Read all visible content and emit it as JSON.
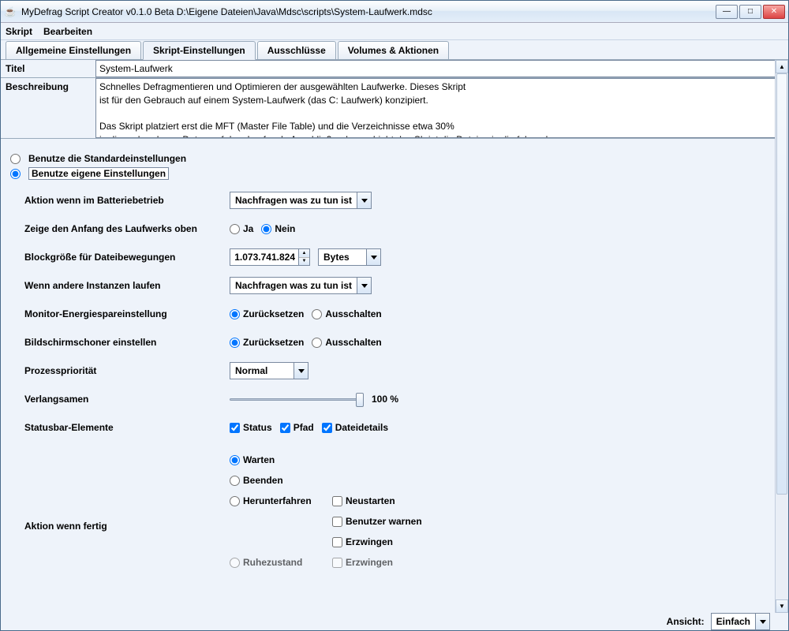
{
  "window": {
    "title": "MyDefrag Script Creator v0.1.0 Beta D:\\Eigene Dateien\\Java\\Mdsc\\scripts\\System-Laufwerk.mdsc"
  },
  "menu": {
    "script": "Skript",
    "edit": "Bearbeiten"
  },
  "tabs": {
    "general": "Allgemeine Einstellungen",
    "script": "Skript-Einstellungen",
    "excludes": "Ausschlüsse",
    "volumes": "Volumes & Aktionen"
  },
  "fields": {
    "title_label": "Titel",
    "title_value": "System-Laufwerk",
    "desc_label": "Beschreibung",
    "desc_value": "Schnelles Defragmentieren und Optimieren der ausgewählten Laufwerke. Dieses Skript\nist für den Gebrauch auf einem System-Laufwerk (das C: Laufwerk) konzipiert.\n\nDas Skript platziert erst die MFT (Master File Table) und die Verzeichnisse etwa 30%\nin die vorhandenen Daten auf dem Laufwerk. Anschließend verschiebt das Skript die Dateien in die folgenden"
  },
  "mode": {
    "default": "Benutze die Standardeinstellungen",
    "custom": "Benutze eigene Einstellungen"
  },
  "settings": {
    "battery_label": "Aktion wenn im Batteriebetrieb",
    "battery_value": "Nachfragen was zu tun ist",
    "showtop_label": "Zeige den Anfang des Laufwerks oben",
    "yes": "Ja",
    "no": "Nein",
    "blocksize_label": "Blockgröße für Dateibewegungen",
    "blocksize_value": "1.073.741.824",
    "blocksize_unit": "Bytes",
    "otherinst_label": "Wenn andere Instanzen laufen",
    "otherinst_value": "Nachfragen was zu tun ist",
    "monitor_label": "Monitor-Energiespareinstellung",
    "reset": "Zurücksetzen",
    "off": "Ausschalten",
    "screensaver_label": "Bildschirmschoner einstellen",
    "priority_label": "Prozesspriorität",
    "priority_value": "Normal",
    "slowdown_label": "Verlangsamen",
    "slowdown_value": "100 %",
    "statusbar_label": "Statusbar-Elemente",
    "sb_status": "Status",
    "sb_path": "Pfad",
    "sb_details": "Dateidetails",
    "done_label": "Aktion wenn fertig",
    "done_wait": "Warten",
    "done_exit": "Beenden",
    "done_shutdown": "Herunterfahren",
    "done_restart": "Neustarten",
    "done_warn": "Benutzer warnen",
    "done_force": "Erzwingen",
    "done_hibernate": "Ruhezustand",
    "done_force2": "Erzwingen"
  },
  "footer": {
    "view_label": "Ansicht:",
    "view_value": "Einfach"
  }
}
